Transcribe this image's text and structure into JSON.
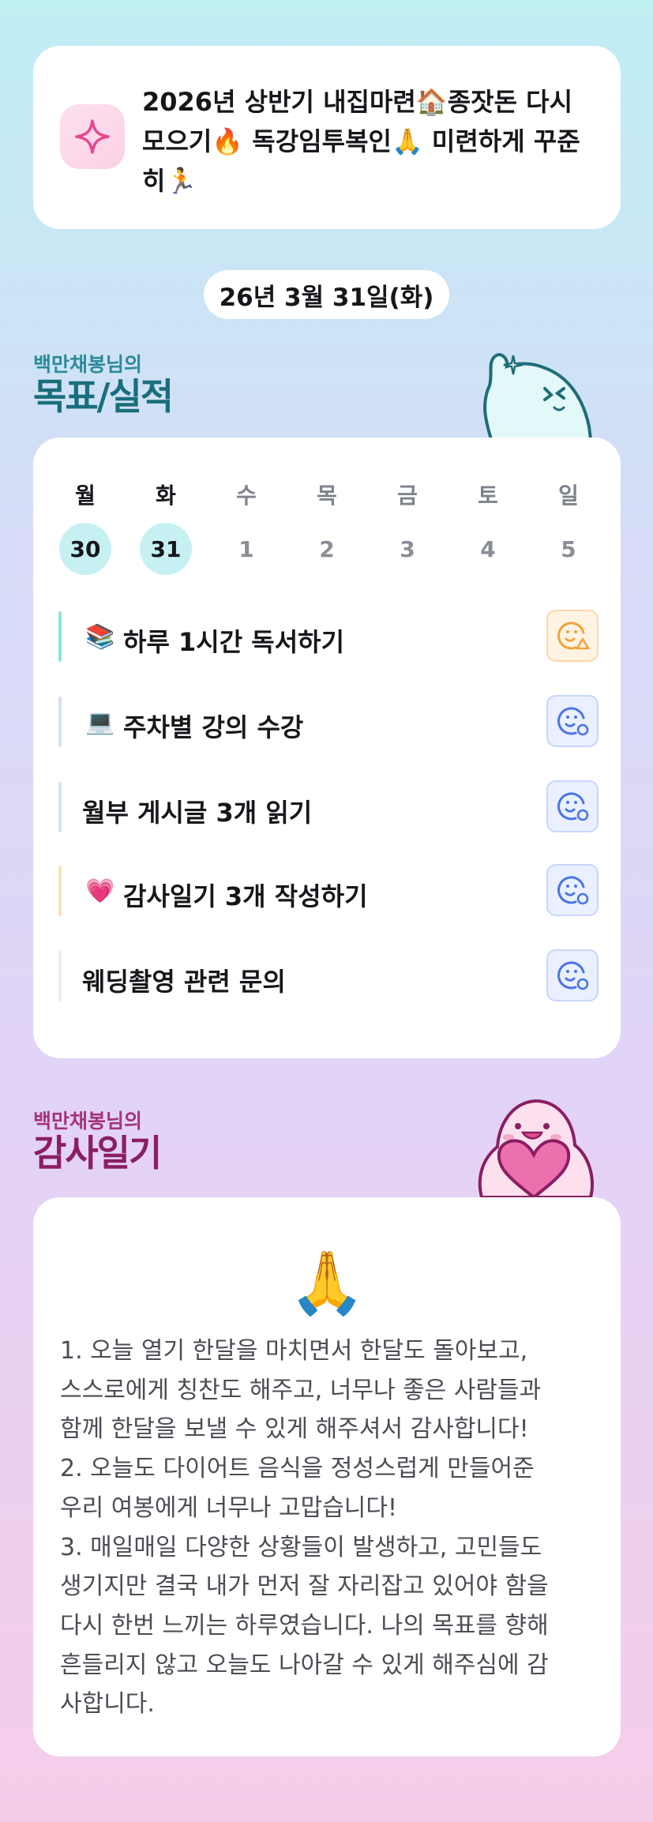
{
  "goal": {
    "icon": "sparkle-icon",
    "text": "2026년 상반기 내집마련🏠종잣돈 다시 모으기🔥 독강임투복인🙏 미련하게 꾸준히🏃"
  },
  "date": "26년 3월 31일(화)",
  "goals_section": {
    "subtitle": "백만채봉님의",
    "title": "목표/실적"
  },
  "week": {
    "days": [
      {
        "label": "월",
        "num": "30",
        "active": true
      },
      {
        "label": "화",
        "num": "31",
        "active": true
      },
      {
        "label": "수",
        "num": "1",
        "active": false
      },
      {
        "label": "목",
        "num": "2",
        "active": false
      },
      {
        "label": "금",
        "num": "3",
        "active": false
      },
      {
        "label": "토",
        "num": "4",
        "active": false
      },
      {
        "label": "일",
        "num": "5",
        "active": false
      }
    ]
  },
  "goals": [
    {
      "emoji": "📚",
      "label": "하루 1시간 독서하기",
      "bar_color": "#8fe3da",
      "status": "pending",
      "status_icon": "face-warning-icon"
    },
    {
      "emoji": "💻",
      "label": "주차별 강의 수강",
      "bar_color": "#d8dff6",
      "status": "todo",
      "status_icon": "face-plus-icon"
    },
    {
      "emoji": "",
      "label": "월부 게시글 3개 읽기",
      "bar_color": "#d8dff6",
      "status": "todo",
      "status_icon": "face-plus-icon"
    },
    {
      "emoji": "💗",
      "label": "감사일기 3개 작성하기",
      "bar_color": "#fbe3b8",
      "status": "todo",
      "status_icon": "face-plus-icon"
    },
    {
      "emoji": "",
      "label": "웨딩촬영 관련 문의",
      "bar_color": "#eceef3",
      "status": "todo",
      "status_icon": "face-plus-icon"
    }
  ],
  "gratitude_section": {
    "subtitle": "백만채봉님의",
    "title": "감사일기"
  },
  "gratitude": {
    "emoji": "🙏",
    "text": "1. 오늘 열기 한달을 마치면서 한달도 돌아보고,\n스스로에게 칭찬도 해주고, 너무나 좋은 사람들과\n함께 한달을 보낼 수 있게 해주셔서 감사합니다!\n2. 오늘도 다이어트 음식을 정성스럽게 만들어준\n우리 여봉에게 너무나 고맙습니다!\n3. 매일매일 다양한 상황들이 발생하고, 고민들도\n생기지만 결국 내가 먼저 잘 자리잡고 있어야 함을\n다시 한번 느끼는 하루였습니다. 나의 목표를 향해\n흔들리지 않고 오늘도 나아갈 수 있게 해주심에 감\n사합니다."
  },
  "colors": {
    "accent_teal": "#1a6e7c",
    "accent_magenta": "#8a1e63",
    "status_pending": "#f0a23c",
    "status_todo": "#4a74e8"
  }
}
